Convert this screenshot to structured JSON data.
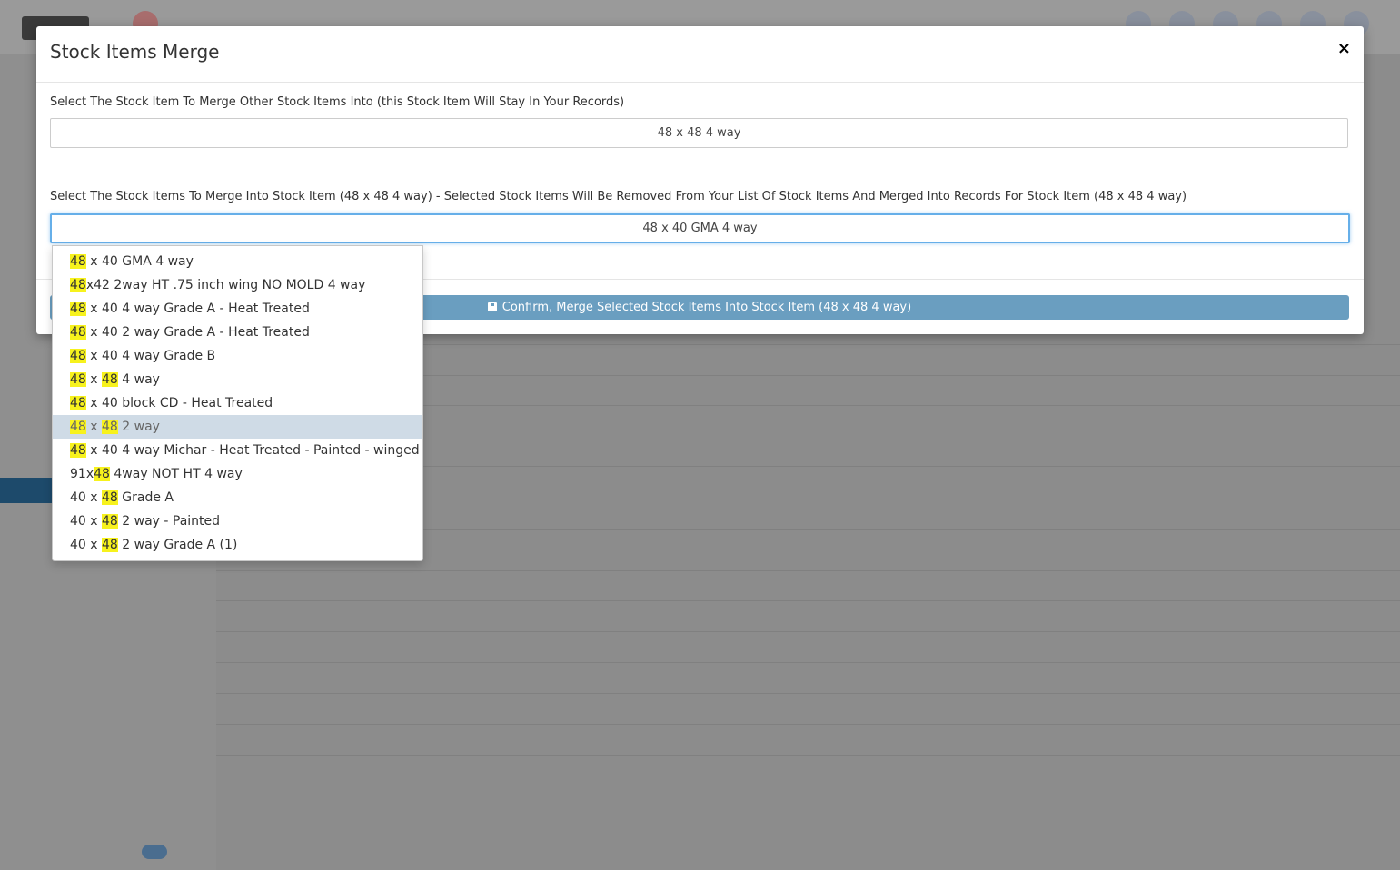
{
  "modal": {
    "title": "Stock Items Merge",
    "close_label": "×",
    "target_label": "Select The Stock Item To Merge Other Stock Items Into (this Stock Item Will Stay In Your Records)",
    "target_value": "48 x 48 4 way",
    "source_label": "Select The Stock Items To Merge Into Stock Item (48 x 48 4 way) - Selected Stock Items Will Be Removed From Your List Of Stock Items And Merged Into Records For Stock Item (48 x 48 4 way)",
    "source_value": "48 x 40 GMA 4 way",
    "confirm_label": "Confirm, Merge Selected Stock Items Into Stock Item (48 x 48 4 way)",
    "confirm_icon": "floppy-save-icon"
  },
  "dropdown": {
    "search_term": "48",
    "highlight_color": "#f7f21d",
    "active_index": 7,
    "items": [
      {
        "segments": [
          {
            "t": "48",
            "h": true
          },
          {
            "t": " x 40 GMA 4 way",
            "h": false
          }
        ]
      },
      {
        "segments": [
          {
            "t": "48",
            "h": true
          },
          {
            "t": "x42 2way HT .75 inch wing NO MOLD 4 way",
            "h": false
          }
        ]
      },
      {
        "segments": [
          {
            "t": "48",
            "h": true
          },
          {
            "t": " x 40 4 way Grade A - Heat Treated",
            "h": false
          }
        ]
      },
      {
        "segments": [
          {
            "t": "48",
            "h": true
          },
          {
            "t": " x 40 2 way Grade A - Heat Treated",
            "h": false
          }
        ]
      },
      {
        "segments": [
          {
            "t": "48",
            "h": true
          },
          {
            "t": " x 40 4 way Grade B",
            "h": false
          }
        ]
      },
      {
        "segments": [
          {
            "t": "48",
            "h": true
          },
          {
            "t": " x ",
            "h": false
          },
          {
            "t": "48",
            "h": true
          },
          {
            "t": " 4 way",
            "h": false
          }
        ]
      },
      {
        "segments": [
          {
            "t": "48",
            "h": true
          },
          {
            "t": " x 40 block CD - Heat Treated",
            "h": false
          }
        ]
      },
      {
        "segments": [
          {
            "t": "48",
            "h": true
          },
          {
            "t": " x ",
            "h": false
          },
          {
            "t": "48",
            "h": true
          },
          {
            "t": " 2 way",
            "h": false
          }
        ]
      },
      {
        "segments": [
          {
            "t": "48",
            "h": true
          },
          {
            "t": " x 40 4 way Michar - Heat Treated - Painted - winged",
            "h": false
          }
        ]
      },
      {
        "segments": [
          {
            "t": "91x",
            "h": false
          },
          {
            "t": "48",
            "h": true
          },
          {
            "t": " 4way NOT HT 4 way",
            "h": false
          }
        ]
      },
      {
        "segments": [
          {
            "t": "40 x ",
            "h": false
          },
          {
            "t": "48",
            "h": true
          },
          {
            "t": " Grade A",
            "h": false
          }
        ]
      },
      {
        "segments": [
          {
            "t": "40 x ",
            "h": false
          },
          {
            "t": "48",
            "h": true
          },
          {
            "t": " 2 way - Painted",
            "h": false
          }
        ]
      },
      {
        "segments": [
          {
            "t": "40 x ",
            "h": false
          },
          {
            "t": "48",
            "h": true
          },
          {
            "t": " 2 way Grade A (1)",
            "h": false
          }
        ]
      }
    ]
  }
}
